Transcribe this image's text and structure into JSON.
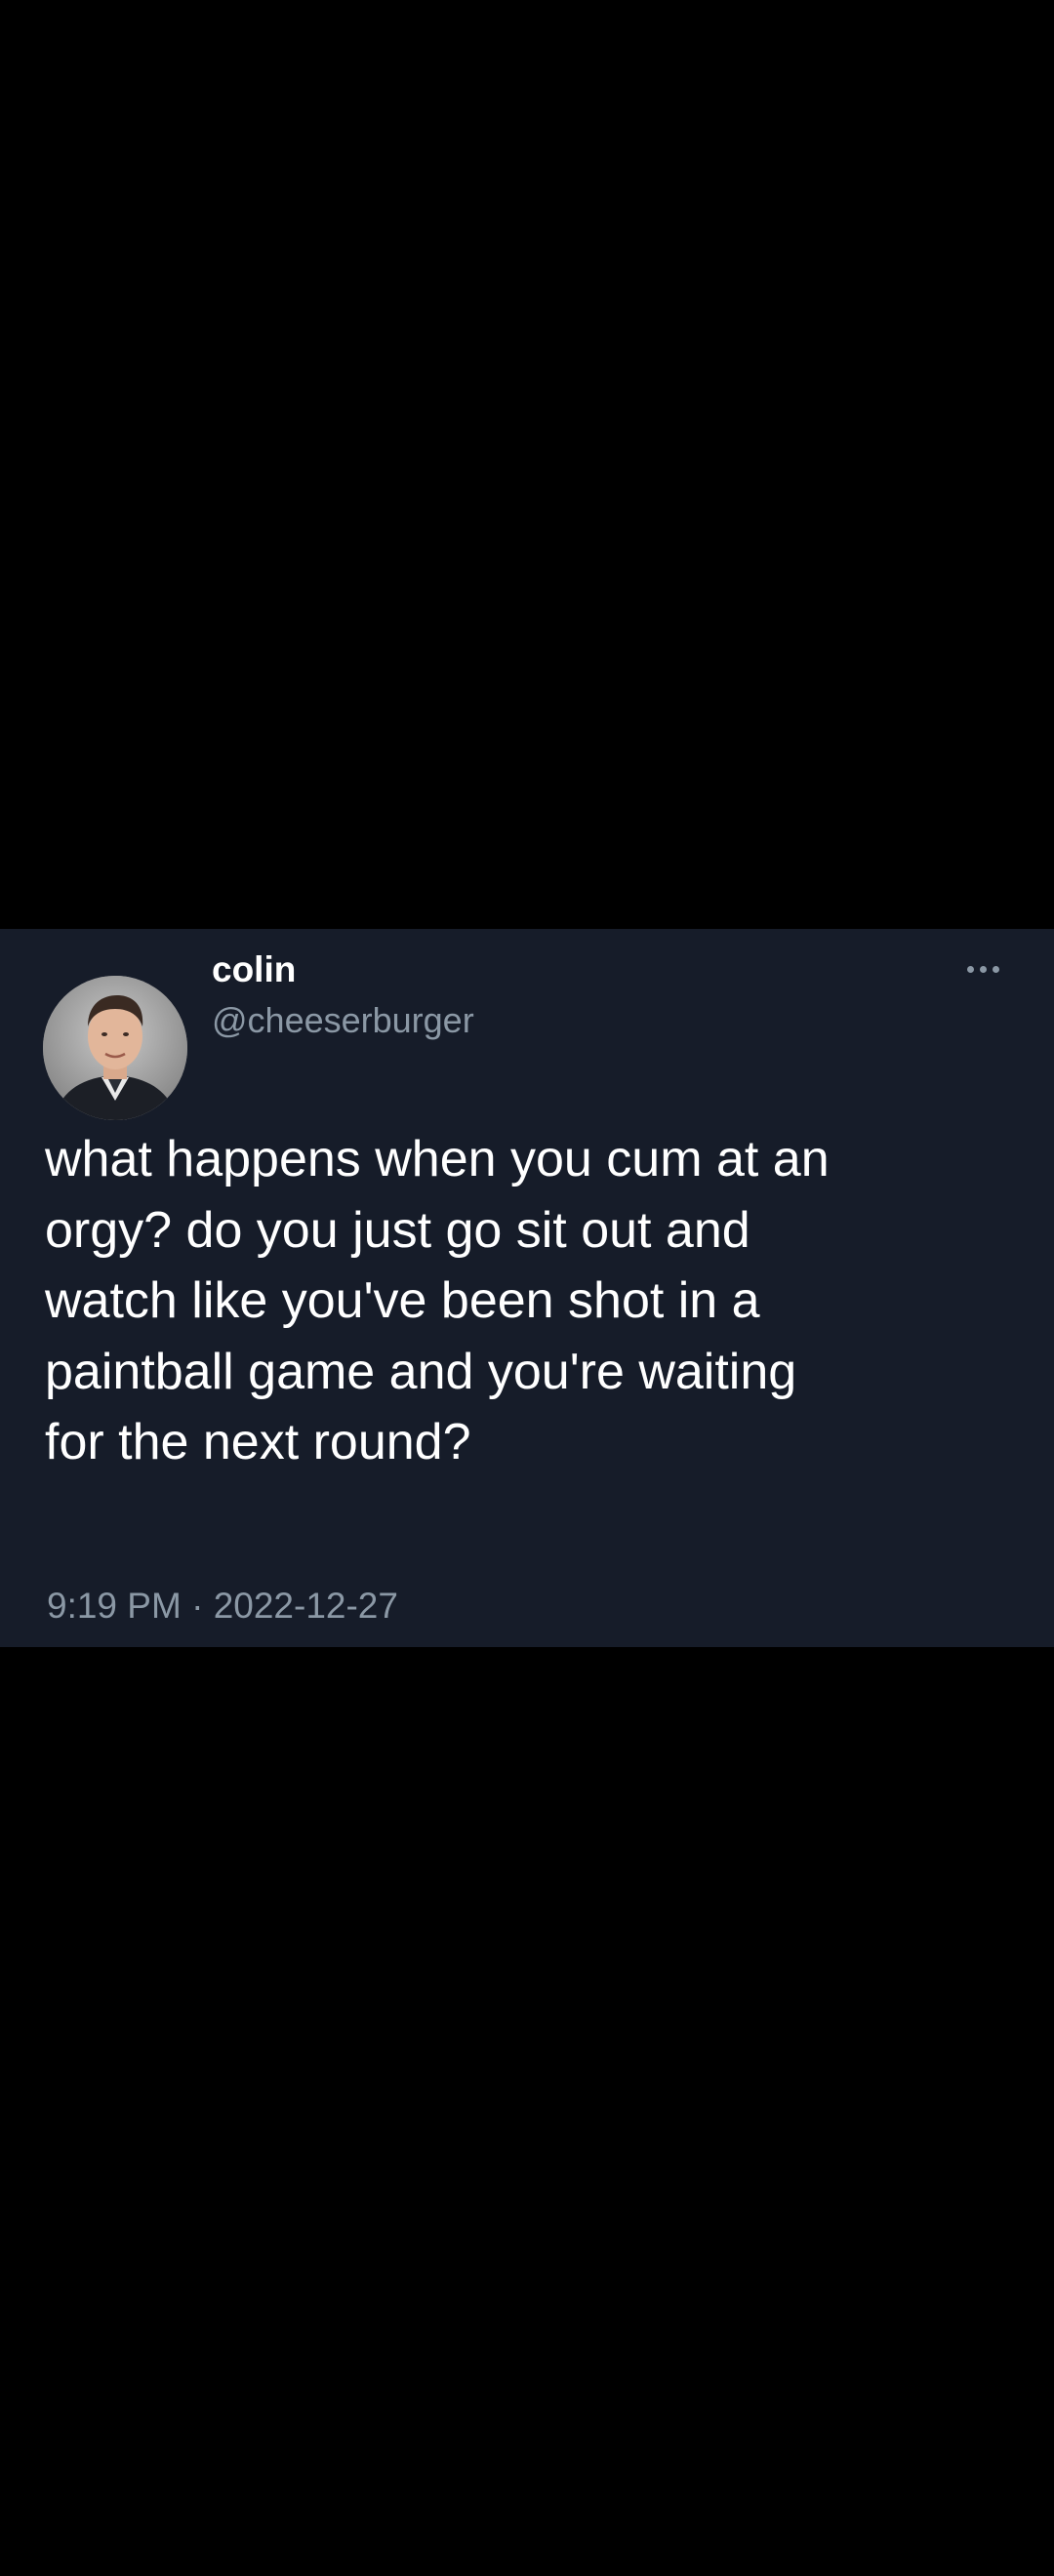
{
  "tweet": {
    "author": {
      "display_name": "colin",
      "handle": "@cheeserburger"
    },
    "text": "what happens when you cum at an\norgy? do you just go sit out and\nwatch like you've been shot in a\npaintball game and you're waiting\nfor the next round?",
    "time": "9:19 PM",
    "separator": "·",
    "date": "2022-12-27",
    "more_icon": "more-horizontal-icon"
  },
  "colors": {
    "page_background": "#000000",
    "card_background": "#161c29",
    "primary_text": "#ffffff",
    "secondary_text": "#8b98a5"
  }
}
